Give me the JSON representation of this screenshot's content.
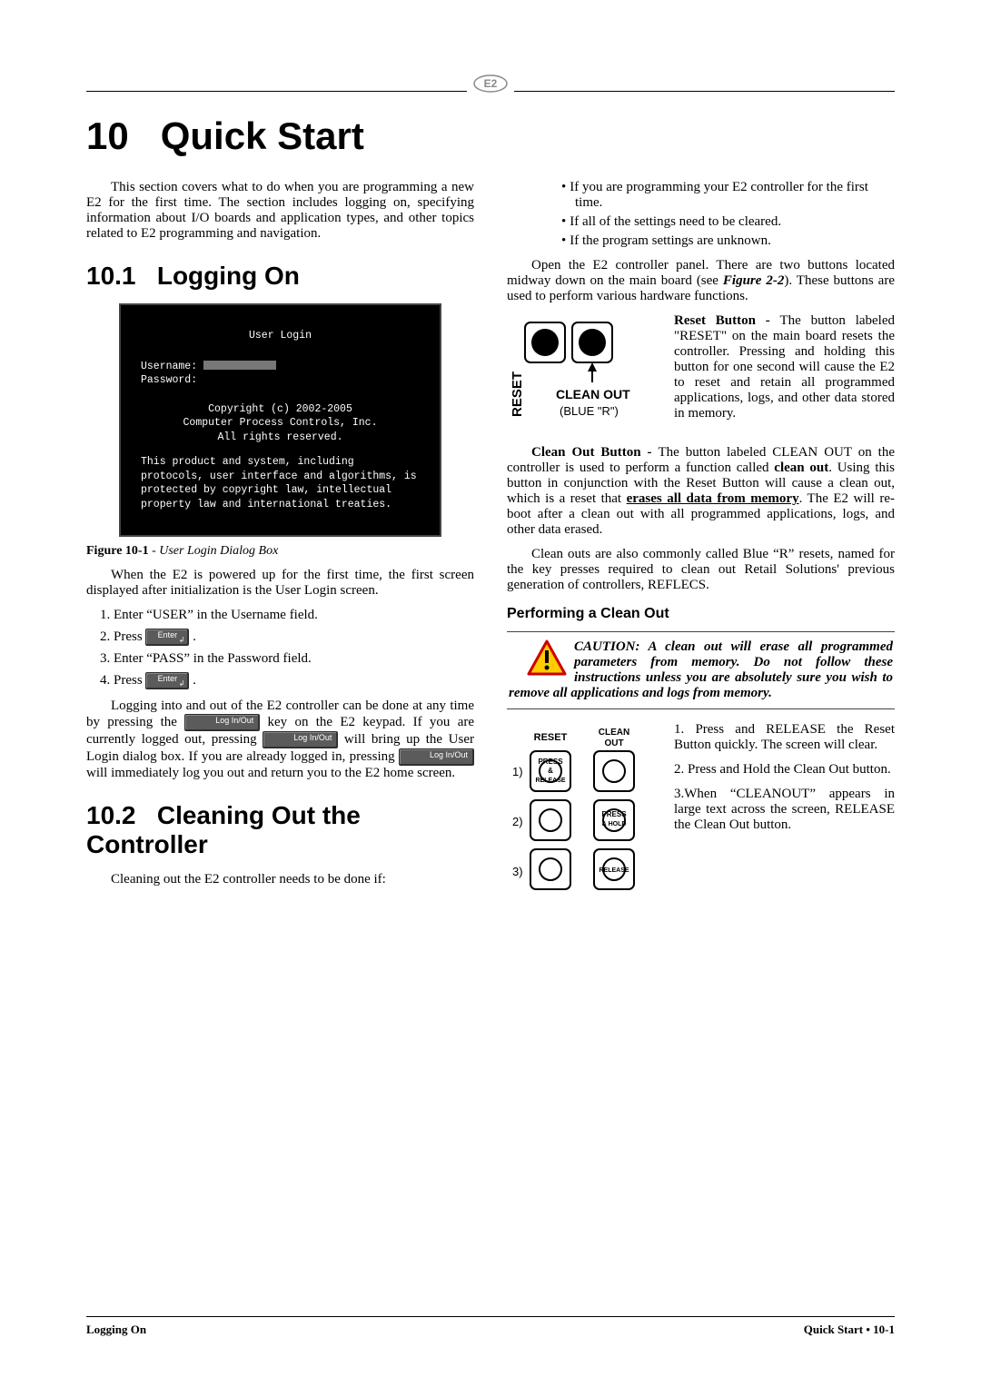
{
  "header": {
    "logo_text": "E2"
  },
  "chapter": {
    "number": "10",
    "title": "Quick Start"
  },
  "intro": "This section covers what to do when you are programming a new E2 for the first time. The section includes logging on, specifying information about I/O boards and application types, and other topics related to E2 programming and navigation.",
  "section_10_1": {
    "number": "10.1",
    "title": "Logging On",
    "login_box": {
      "title": "User Login",
      "username_label": "Username:",
      "password_label": "Password:",
      "copyright_line1": "Copyright (c) 2002-2005",
      "copyright_line2": "Computer Process Controls, Inc.",
      "copyright_line3": "All rights reserved.",
      "legal": "This product and system, including protocols, user interface and algorithms, is protected by copyright law, intellectual property law and international treaties."
    },
    "fig_caption_bold": "Figure 10-1",
    "fig_caption_rest": " - User Login Dialog Box",
    "para_after_fig": "When the E2 is powered up for the first time, the first screen displayed after initialization is the User Login screen.",
    "steps": [
      "Enter “USER” in the Username field.",
      "Press",
      "Enter “PASS” in the Password field.",
      "Press"
    ],
    "key_enter": "Enter",
    "key_log": "Log In/Out",
    "para_login_a": "Logging into and out of the E2 controller can be done at any time by pressing the ",
    "para_login_b": " key on the E2 keypad. If you are currently logged out, pressing ",
    "para_login_c": " will bring up the User Login dialog box. If you are already logged in, pressing ",
    "para_login_d": " will immediately log you out and return you to the E2 home screen."
  },
  "section_10_2": {
    "number": "10.2",
    "title": "Cleaning Out the Controller",
    "lead": "Cleaning out the E2 controller needs to be done if:",
    "bullets": [
      "If you are programming your E2 controller for the first time.",
      "If all of the settings need to be cleared.",
      "If the program settings are unknown."
    ],
    "col2_open_a": "Open the E2 controller panel. There are two buttons located midway down on the main board (see ",
    "col2_open_fig": "Figure 2-2",
    "col2_open_b": "). These buttons are used to perform various hardware functions.",
    "reset_label": "RESET",
    "cleanout_label": "CLEAN OUT",
    "blue_r": "(BLUE “R”)",
    "reset_para_lead": "Reset Button - ",
    "reset_para": "The button labeled \"RESET\" on the main board resets the controller. Pressing and holding this button for one second will cause the E2 to reset and retain all programmed applications, logs, and other data stored in memory.",
    "cleanout_para_lead": "Clean Out Button - ",
    "cleanout_para_a": "The button labeled CLEAN OUT on the controller is used to perform a function called ",
    "cleanout_bold1": "clean out",
    "cleanout_para_b": ". Using this button in conjunction with the Reset Button will cause a clean out, which is a reset that ",
    "cleanout_underline": "erases all data from memory",
    "cleanout_para_c": ". The E2 will re-boot after a clean out with all programmed applications, logs, and other data erased.",
    "blue_r_para": "Clean outs are also commonly called Blue “R” resets, named for the key presses required to clean out Retail Solutions' previous generation of controllers, REFLECS.",
    "performing_heading": "Performing a Clean Out",
    "caution": "CAUTION: A clean out will erase all programmed parameters from memory. Do not follow these instructions unless you are absolutely sure you wish to remove all applications and logs from memory.",
    "diagram": {
      "reset": "RESET",
      "clean": "CLEAN",
      "out": "OUT",
      "press": "PRESS",
      "and": "&",
      "release": "RELEASE",
      "hold": "& HOLD",
      "n1": "1)",
      "n2": "2)",
      "n3": "3)"
    },
    "step1": "1. Press and RELEASE the Reset Button quickly. The screen will clear.",
    "step2": "2. Press and Hold the Clean Out button.",
    "step3": "3.When “CLEANOUT” appears in large text across the screen, RELEASE the Clean Out button."
  },
  "footer": {
    "left": "Logging On",
    "right": "Quick Start • 10-1"
  }
}
